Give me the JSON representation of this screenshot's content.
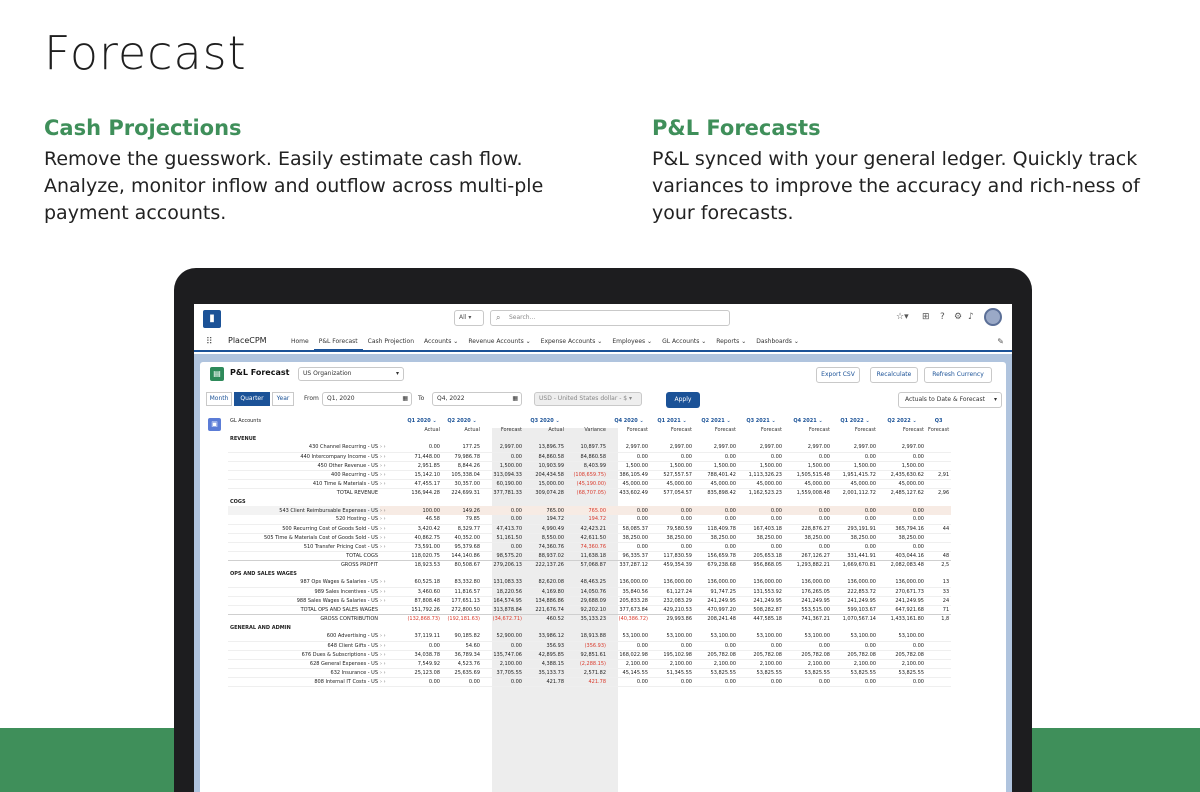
{
  "page": {
    "title": "Forecast",
    "features": [
      {
        "heading": "Cash Projections",
        "body": "Remove the guesswork. Easily estimate cash flow. Analyze, monitor inflow and outflow across multi-ple payment accounts."
      },
      {
        "heading": "P&L Forecasts",
        "body": "P&L synced with your general ledger. Quickly track variances to improve the accuracy and rich-ness of your forecasts."
      }
    ],
    "colors": {
      "accent": "#3f8f5a",
      "sf_blue": "#1b5297",
      "negative": "#d9392b"
    }
  },
  "app": {
    "name": "PlaceCPM",
    "search_scope": "All",
    "search_placeholder": "Search...",
    "icons": [
      "waffle-icon",
      "search-icon",
      "help-icon",
      "gear-icon",
      "bell-icon",
      "pencil-icon"
    ],
    "nav_tabs": [
      {
        "label": "Home",
        "active": false
      },
      {
        "label": "P&L Forecast",
        "active": true
      },
      {
        "label": "Cash Projection",
        "active": false
      },
      {
        "label": "Accounts ⌄",
        "active": false
      },
      {
        "label": "Revenue Accounts ⌄",
        "active": false
      },
      {
        "label": "Expense Accounts ⌄",
        "active": false
      },
      {
        "label": "Employees ⌄",
        "active": false
      },
      {
        "label": "GL Accounts ⌄",
        "active": false
      },
      {
        "label": "Reports ⌄",
        "active": false
      },
      {
        "label": "Dashboards ⌄",
        "active": false
      }
    ]
  },
  "forecast": {
    "title": "P&L Forecast",
    "org": "US Organization",
    "buttons": {
      "export": "Export CSV",
      "recalc": "Recalculate",
      "refresh": "Refresh Currency"
    },
    "periods": {
      "month": "Month",
      "quarter": "Quarter",
      "year": "Year"
    },
    "from_label": "From",
    "from_value": "Q1, 2020",
    "to_label": "To",
    "to_value": "Q4, 2022",
    "currency": "USD - United States dollar - $",
    "apply": "Apply",
    "mode": "Actuals to Date & Forecast",
    "gl_header": "GL Accounts",
    "quarters": [
      "Q1 2020 ⌄",
      "Q2 2020 ⌄",
      "Q3 2020 ⌄",
      "Q4 2020 ⌄",
      "Q1 2021 ⌄",
      "Q2 2021 ⌄",
      "Q3 2021 ⌄",
      "Q4 2021 ⌄",
      "Q1 2022 ⌄",
      "Q2 2022 ⌄",
      "Q3"
    ],
    "subheaders": [
      "Actual",
      "Actual",
      "Forecast",
      "Actual",
      "Variance",
      "Forecast",
      "Forecast",
      "Forecast",
      "Forecast",
      "Forecast",
      "Forecast",
      "Forecast",
      "Forecast"
    ],
    "rows": [
      {
        "type": "section",
        "label": "REVENUE"
      },
      {
        "type": "row",
        "label": "430 Channel Recurring - US",
        "values": [
          "0.00",
          "177.25",
          "2,997.00",
          "13,896.75",
          "10,897.75",
          "2,997.00",
          "2,997.00",
          "2,997.00",
          "2,997.00",
          "2,997.00",
          "2,997.00",
          "2,997.00",
          ""
        ]
      },
      {
        "type": "row",
        "label": "440 Intercompany Income - US",
        "values": [
          "71,448.00",
          "79,986.78",
          "0.00",
          "84,860.58",
          "84,860.58",
          "0.00",
          "0.00",
          "0.00",
          "0.00",
          "0.00",
          "0.00",
          "0.00",
          ""
        ]
      },
      {
        "type": "row",
        "label": "450 Other Revenue - US",
        "values": [
          "2,951.85",
          "8,844.26",
          "1,500.00",
          "10,903.99",
          "8,403.99",
          "1,500.00",
          "1,500.00",
          "1,500.00",
          "1,500.00",
          "1,500.00",
          "1,500.00",
          "1,500.00",
          ""
        ]
      },
      {
        "type": "row",
        "label": "400 Recurring - US",
        "values": [
          "15,142.10",
          "105,338.04",
          "313,094.33",
          "204,434.58",
          "(108,659.75)",
          "386,105.49",
          "527,557.57",
          "788,401.42",
          "1,113,326.23",
          "1,505,515.48",
          "1,951,415.72",
          "2,435,630.62",
          "2,91"
        ],
        "neg": [
          4
        ]
      },
      {
        "type": "row",
        "label": "410 Time & Materials - US",
        "values": [
          "47,455.17",
          "30,357.00",
          "60,190.00",
          "15,000.00",
          "(45,190.00)",
          "45,000.00",
          "45,000.00",
          "45,000.00",
          "45,000.00",
          "45,000.00",
          "45,000.00",
          "45,000.00",
          ""
        ],
        "neg": [
          4
        ]
      },
      {
        "type": "total",
        "label": "TOTAL REVENUE",
        "values": [
          "136,944.28",
          "224,699.31",
          "377,781.33",
          "309,074.28",
          "(68,707.05)",
          "433,602.49",
          "577,054.57",
          "835,898.42",
          "1,162,523.23",
          "1,559,008.48",
          "2,001,112.72",
          "2,485,127.62",
          "2,96"
        ],
        "neg": [
          4
        ]
      },
      {
        "type": "section",
        "label": "COGS"
      },
      {
        "type": "hl",
        "label": "543 Client Reimbursable Expenses - US",
        "values": [
          "100.00",
          "149.26",
          "0.00",
          "765.00",
          "765.00",
          "0.00",
          "0.00",
          "0.00",
          "0.00",
          "0.00",
          "0.00",
          "0.00",
          ""
        ],
        "neg": [
          4
        ]
      },
      {
        "type": "row",
        "label": "520 Hosting - US",
        "values": [
          "46.58",
          "79.85",
          "0.00",
          "194.72",
          "194.72",
          "0.00",
          "0.00",
          "0.00",
          "0.00",
          "0.00",
          "0.00",
          "0.00",
          ""
        ],
        "neg": [
          4
        ]
      },
      {
        "type": "row",
        "label": "500 Recurring Cost of Goods Sold - US",
        "values": [
          "3,420.42",
          "8,329.77",
          "47,413.70",
          "4,990.49",
          "42,423.21",
          "58,085.37",
          "79,580.59",
          "118,409.78",
          "167,403.18",
          "228,876.27",
          "293,191.91",
          "365,794.16",
          "44"
        ]
      },
      {
        "type": "row",
        "label": "505 Time & Materials Cost of Goods Sold - US",
        "values": [
          "40,862.75",
          "40,352.00",
          "51,161.50",
          "8,550.00",
          "42,611.50",
          "38,250.00",
          "38,250.00",
          "38,250.00",
          "38,250.00",
          "38,250.00",
          "38,250.00",
          "38,250.00",
          ""
        ]
      },
      {
        "type": "row",
        "label": "510 Transfer Pricing Cost - US",
        "values": [
          "73,591.00",
          "95,379.68",
          "0.00",
          "74,360.76",
          "74,360.76",
          "0.00",
          "0.00",
          "0.00",
          "0.00",
          "0.00",
          "0.00",
          "0.00",
          ""
        ],
        "neg": [
          4
        ]
      },
      {
        "type": "total",
        "label": "TOTAL COGS",
        "values": [
          "118,020.75",
          "144,140.86",
          "98,575.20",
          "88,937.02",
          "11,638.18",
          "96,335.37",
          "117,830.59",
          "156,659.78",
          "205,653.18",
          "267,126.27",
          "331,441.91",
          "403,044.16",
          "48"
        ]
      },
      {
        "type": "total",
        "label": "GROSS PROFIT",
        "values": [
          "18,923.53",
          "80,508.67",
          "279,206.13",
          "222,137.26",
          "57,068.87",
          "337,287.12",
          "459,354.39",
          "679,238.68",
          "956,868.05",
          "1,293,882.21",
          "1,669,670.81",
          "2,082,083.48",
          "2,5"
        ]
      },
      {
        "type": "section",
        "label": "OPS AND SALES WAGES"
      },
      {
        "type": "row",
        "label": "987 Ops Wages & Salaries - US",
        "values": [
          "60,525.18",
          "83,332.80",
          "131,083.33",
          "82,620.08",
          "48,463.25",
          "136,000.00",
          "136,000.00",
          "136,000.00",
          "136,000.00",
          "136,000.00",
          "136,000.00",
          "136,000.00",
          "13"
        ]
      },
      {
        "type": "row",
        "label": "989 Sales Incentives - US",
        "values": [
          "3,460.60",
          "11,816.57",
          "18,220.56",
          "4,169.80",
          "14,050.76",
          "35,840.56",
          "61,127.24",
          "91,747.25",
          "131,553.92",
          "176,265.05",
          "222,853.72",
          "270,671.73",
          "33"
        ]
      },
      {
        "type": "row",
        "label": "988 Sales Wages & Salaries - US",
        "values": [
          "87,808.48",
          "177,651.13",
          "164,574.95",
          "134,886.86",
          "29,688.09",
          "205,833.28",
          "232,083.29",
          "241,249.95",
          "241,249.95",
          "241,249.95",
          "241,249.95",
          "241,249.95",
          "24"
        ]
      },
      {
        "type": "total",
        "label": "TOTAL OPS AND SALES WAGES",
        "values": [
          "151,792.26",
          "272,800.50",
          "313,878.84",
          "221,676.74",
          "92,202.10",
          "377,673.84",
          "429,210.53",
          "470,997.20",
          "508,282.87",
          "553,515.00",
          "599,103.67",
          "647,921.68",
          "71"
        ]
      },
      {
        "type": "total",
        "label": "GROSS CONTRIBUTION",
        "values": [
          "(132,868.73)",
          "(192,181.63)",
          "(34,672.71)",
          "460.52",
          "35,133.23",
          "(40,386.72)",
          "29,993.86",
          "208,241.48",
          "447,585.18",
          "741,367.21",
          "1,070,567.14",
          "1,433,161.80",
          "1,8"
        ],
        "neg": [
          0,
          1,
          2,
          5
        ]
      },
      {
        "type": "section",
        "label": "GENERAL AND ADMIN"
      },
      {
        "type": "row",
        "label": "600 Advertising - US",
        "values": [
          "37,119.11",
          "90,185.82",
          "52,900.00",
          "33,986.12",
          "18,913.88",
          "53,100.00",
          "53,100.00",
          "53,100.00",
          "53,100.00",
          "53,100.00",
          "53,100.00",
          "53,100.00",
          ""
        ]
      },
      {
        "type": "row",
        "label": "648 Client Gifts - US",
        "values": [
          "0.00",
          "54.60",
          "0.00",
          "356.93",
          "(356.93)",
          "0.00",
          "0.00",
          "0.00",
          "0.00",
          "0.00",
          "0.00",
          "0.00",
          ""
        ],
        "neg": [
          4
        ]
      },
      {
        "type": "row",
        "label": "676 Dues & Subscriptions - US",
        "values": [
          "34,038.78",
          "36,789.34",
          "135,747.06",
          "42,895.85",
          "92,851.61",
          "168,022.98",
          "195,102.98",
          "205,782.08",
          "205,782.08",
          "205,782.08",
          "205,782.08",
          "205,782.08",
          ""
        ]
      },
      {
        "type": "row",
        "label": "628 General Expenses - US",
        "values": [
          "7,549.92",
          "4,523.76",
          "2,100.00",
          "4,388.15",
          "(2,288.15)",
          "2,100.00",
          "2,100.00",
          "2,100.00",
          "2,100.00",
          "2,100.00",
          "2,100.00",
          "2,100.00",
          ""
        ],
        "neg": [
          4
        ]
      },
      {
        "type": "row",
        "label": "632 Insurance - US",
        "values": [
          "25,123.08",
          "25,635.69",
          "37,705.55",
          "35,133.73",
          "2,571.82",
          "45,145.55",
          "51,345.55",
          "53,825.55",
          "53,825.55",
          "53,825.55",
          "53,825.55",
          "53,825.55",
          ""
        ]
      },
      {
        "type": "row",
        "label": "808 Internal IT Costs - US",
        "values": [
          "0.00",
          "0.00",
          "0.00",
          "421.78",
          "421.78",
          "0.00",
          "0.00",
          "0.00",
          "0.00",
          "0.00",
          "0.00",
          "0.00",
          ""
        ],
        "neg": [
          4
        ]
      }
    ]
  }
}
